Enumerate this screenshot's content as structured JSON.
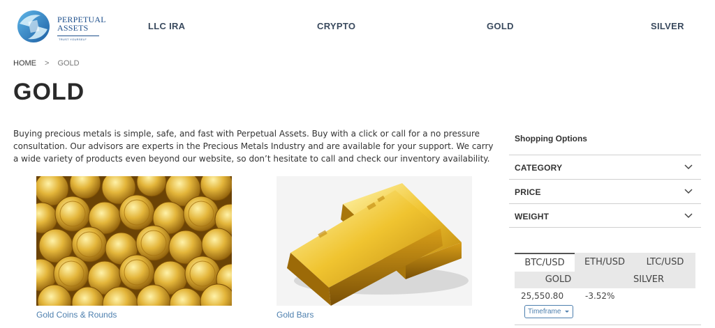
{
  "header": {
    "logo": {
      "name_line1": "PERPETUAL",
      "name_line2": "ASSETS",
      "tagline": "TRUST YOURSELF"
    },
    "nav": [
      {
        "label": "LLC IRA"
      },
      {
        "label": "CRYPTO"
      },
      {
        "label": "GOLD"
      },
      {
        "label": "SILVER"
      }
    ]
  },
  "breadcrumb": {
    "home": "HOME",
    "separator": ">",
    "current": "GOLD"
  },
  "page_title": "GOLD",
  "intro": "Buying precious metals is simple, safe, and fast with Perpetual Assets. Buy with a click or call for a no pressure consultation. Our advisors are experts in the Precious Metals Industry and are available for your support. We carry a wide variety of products even beyond our website, so don’t hesitate to call and check our inventory availability.",
  "products": [
    {
      "label": "Gold Coins & Rounds",
      "image": "gold-coins-image"
    },
    {
      "label": "Gold Bars",
      "image": "gold-bars-image"
    }
  ],
  "sidebar": {
    "title": "Shopping Options",
    "filters": [
      {
        "label": "CATEGORY",
        "icon": "chevron-down-icon"
      },
      {
        "label": "PRICE",
        "icon": "chevron-down-icon"
      },
      {
        "label": "WEIGHT",
        "icon": "chevron-down-icon"
      }
    ]
  },
  "ticker": {
    "tabs": [
      {
        "label": "BTC/USD",
        "active": true
      },
      {
        "label": "ETH/USD",
        "active": false
      },
      {
        "label": "LTC/USD",
        "active": false
      }
    ],
    "subtabs": [
      {
        "label": "GOLD"
      },
      {
        "label": "SILVER"
      }
    ],
    "price": "25,550.80",
    "change": "-3.52%",
    "timeframe_label": "Timeframe"
  },
  "colors": {
    "brand": "#1d4f8c",
    "link": "#4d7fae",
    "nav_text": "#3a4a5e",
    "gold": "#d9a520"
  }
}
